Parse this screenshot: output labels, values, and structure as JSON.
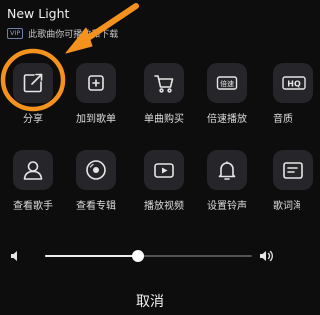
{
  "header": {
    "song_title": "New Light",
    "vip_badge": "VIP",
    "vip_text": "此歌曲你可播放和下载"
  },
  "actions": [
    {
      "label": "分享",
      "icon": "share-icon"
    },
    {
      "label": "加到歌单",
      "icon": "add-to-playlist-icon"
    },
    {
      "label": "单曲购买",
      "icon": "cart-icon"
    },
    {
      "label": "倍速播放",
      "icon": "speed-icon",
      "icon_text": "倍速"
    },
    {
      "label": "音质",
      "icon": "quality-icon",
      "icon_text": "HQ"
    },
    {
      "label": "查看歌手",
      "icon": "singer-icon"
    },
    {
      "label": "查看专辑",
      "icon": "album-icon"
    },
    {
      "label": "播放视频",
      "icon": "video-icon"
    },
    {
      "label": "设置铃声",
      "icon": "bell-icon"
    },
    {
      "label": "歌词海",
      "icon": "lyrics-icon"
    }
  ],
  "volume": {
    "level": 0.45
  },
  "footer": {
    "cancel_label": "取消"
  },
  "annotation": {
    "color": "#f5921e"
  }
}
